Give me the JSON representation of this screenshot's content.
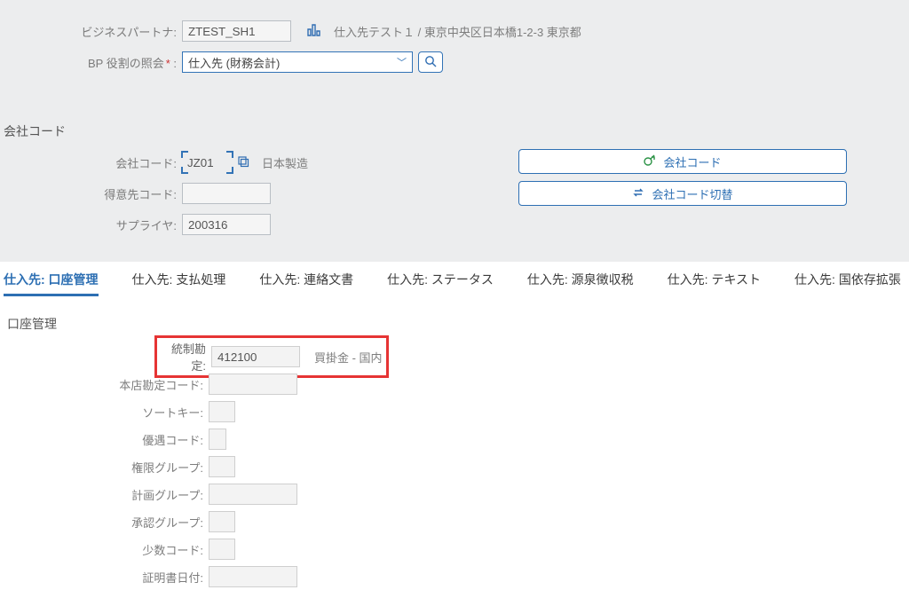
{
  "header": {
    "bp_label": "ビジネスパートナ:",
    "bp_value": "ZTEST_SH1",
    "bp_desc": "仕入先テスト１ / 東京中央区日本橋1-2-3 東京都",
    "role_label": "BP 役割の照会",
    "role_value": "仕入先 (財務会計)"
  },
  "cc": {
    "title": "会社コード",
    "code_label": "会社コード:",
    "code_value": "JZ01",
    "code_name": "日本製造",
    "cust_label": "得意先コード:",
    "cust_value": "",
    "supp_label": "サプライヤ:",
    "supp_value": "200316",
    "btn1": "会社コード",
    "btn2": "会社コード切替"
  },
  "tabs": {
    "t1": "仕入先: 口座管理",
    "t2": "仕入先: 支払処理",
    "t3": "仕入先: 連絡文書",
    "t4": "仕入先: ステータス",
    "t5": "仕入先: 源泉徴収税",
    "t6": "仕入先: テキスト",
    "t7": "仕入先: 国依存拡張"
  },
  "form": {
    "title": "口座管理",
    "recon_label": "統制勘定:",
    "recon_value": "412100",
    "recon_desc": "買掛金 - 国内",
    "head_label": "本店勘定コード:",
    "sort_label": "ソートキー:",
    "pref_label": "優遇コード:",
    "auth_label": "権限グループ:",
    "plan_label": "計画グループ:",
    "appr_label": "承認グループ:",
    "min_label": "少数コード:",
    "cert_label": "証明書日付:"
  }
}
